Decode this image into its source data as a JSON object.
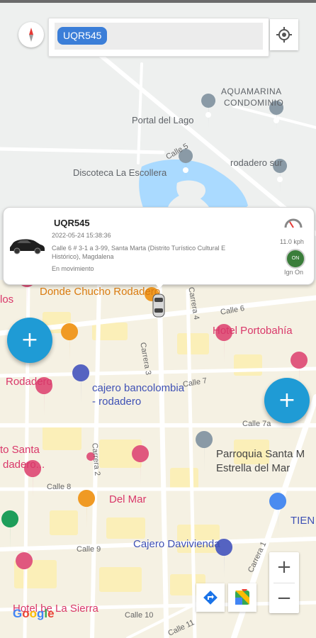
{
  "search": {
    "plate_chip": "UQR545"
  },
  "vehicle_card": {
    "plate": "UQR545",
    "datetime": "2022-05-24 15:38:36",
    "address": "Calle 6 # 3-1 a 3-99, Santa Marta (Distrito Turístico Cultural E Histórico), Magdalena",
    "status": "En movimiento",
    "speed": "11.0 kph",
    "ignition_badge": "ON",
    "ignition": "Ign On"
  },
  "map_labels": {
    "aquamarina1": "AQUAMARINA",
    "aquamarina2": "CONDOMINIO",
    "portal": "Portal del Lago",
    "discoteca": "Discoteca La Escollera",
    "rodadero_sur": "rodadero sur",
    "calle5": "Calle 5",
    "donde_chucho": "Donde Chucho Rodadero",
    "los": "los",
    "calle6": "Calle 6",
    "carrera4": "Carrera 4",
    "portobahia": "Hotel Portobahía",
    "carrera3": "Carrera 3",
    "calle7": "Calle 7",
    "rodadero": "Rodadero",
    "cajero_banco1": "cajero bancolombia",
    "cajero_banco2": "- rodadero",
    "calle7a": "Calle 7a",
    "santa1": "to Santa",
    "santa2": "dadero...",
    "carrera2": "Carrera 2",
    "parroquia1": "Parroquia Santa M",
    "parroquia2": "Estrella del Mar",
    "calle8": "Calle 8",
    "del_mar": "Del Mar",
    "tien": "TIEN",
    "calle9": "Calle 9",
    "cajero_davivienda": "Cajero Davivienda",
    "carrera1": "Carrera 1",
    "hotel_sierra": "Hotel be La Sierra",
    "calle10": "Calle 10",
    "calle11": "Calle 11"
  },
  "controls": {
    "add": "+",
    "zoom_in": "+",
    "zoom_out": "−"
  },
  "google": {
    "g1": "G",
    "o1": "o",
    "o2": "o",
    "g2": "g",
    "l": "l",
    "e": "e"
  },
  "icons": {
    "compass": "compass-icon",
    "locate": "my-location-icon",
    "directions": "directions-icon",
    "maps": "google-maps-icon"
  },
  "colors": {
    "accent_blue": "#1f9bd5",
    "plate_chip": "#3b7ed8",
    "poi_red": "#d9386a",
    "poi_blue": "#3f51b5",
    "water": "#aadaff",
    "highlight_area": "#fbefb8"
  }
}
